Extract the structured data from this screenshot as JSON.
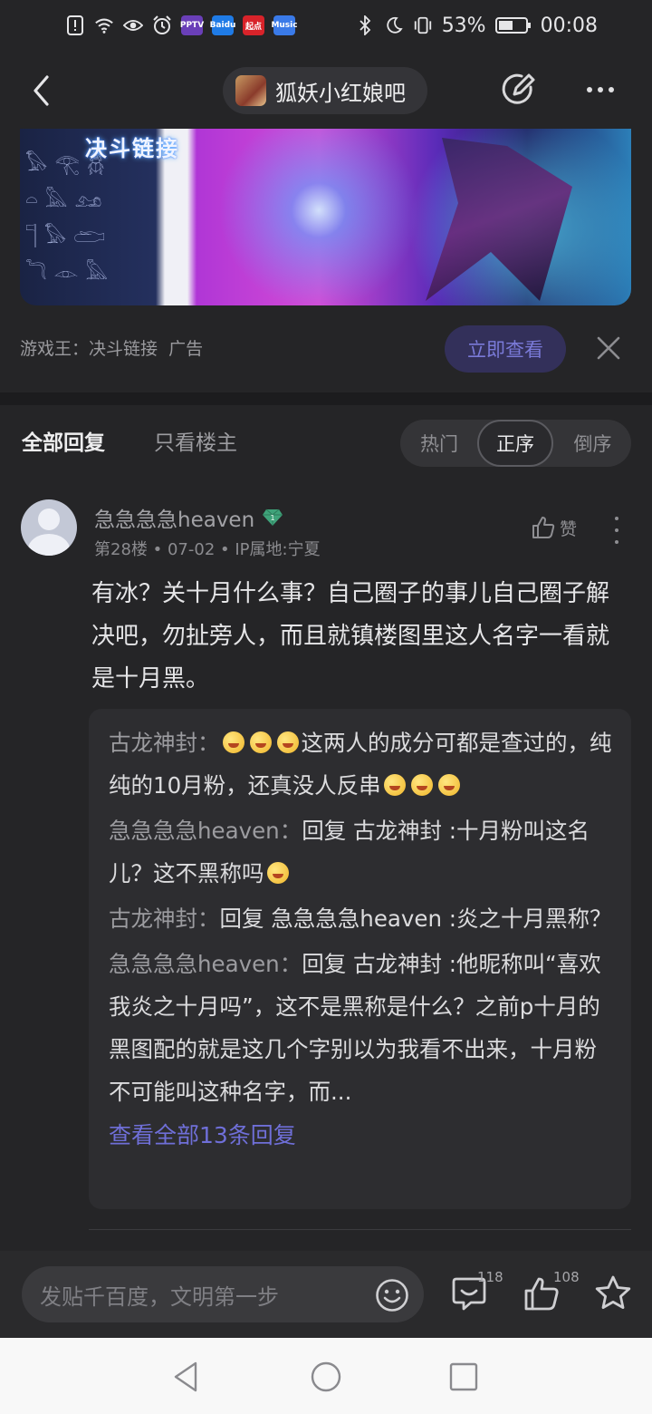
{
  "status_bar": {
    "battery": "53%",
    "time": "00:08",
    "app_badges": [
      "PPTV",
      "Baidu",
      "起点",
      "Music"
    ]
  },
  "header": {
    "forum_name": "狐妖小红娘吧",
    "forum_avatar_text": "狐妖小红娘"
  },
  "ad": {
    "banner_logo": "决斗链接",
    "source": "游戏王：决斗链接",
    "tag": "广告",
    "cta": "立即查看"
  },
  "filter": {
    "all_replies": "全部回复",
    "owner_only": "只看楼主",
    "sort_hot": "热门",
    "sort_asc": "正序",
    "sort_desc": "倒序",
    "selected": "正序"
  },
  "post": {
    "username": "急急急急heaven",
    "floor": "第28楼",
    "date": "07-02",
    "ip": "IP属地:宁夏",
    "like_label": "赞",
    "body": "有冰？关十月什么事？自己圈子的事儿自己圈子解决吧，勿扯旁人，而且就镇楼图里这人名字一看就是十月黑。"
  },
  "sub_replies": [
    {
      "who": "古龙神封：",
      "text_before": "",
      "text": "这两人的成分可都是查过的，纯纯的10月粉，还真没人反串"
    },
    {
      "who": "急急急急heaven：",
      "text": "回复 古龙神封 :十月粉叫这名儿？这不黑称吗"
    },
    {
      "who": "古龙神封：",
      "text": "回复 急急急急heaven :炎之十月黑称？"
    },
    {
      "who": "急急急急heaven：",
      "text": "回复 古龙神封 :他昵称叫“喜欢我炎之十月吗”，这不是黑称是什么？之前p十月的黑图配的就是这几个字别以为我看不出来，十月粉不可能叫这种名字，而..."
    }
  ],
  "view_all": "查看全部13条回复",
  "bottom_bar": {
    "composer_placeholder": "发贴千百度，文明第一步",
    "comment_count": "118",
    "like_count": "108"
  },
  "colors": {
    "background": "#252527",
    "accent_link": "#6f6fd8",
    "cta_bg": "#33305a"
  }
}
